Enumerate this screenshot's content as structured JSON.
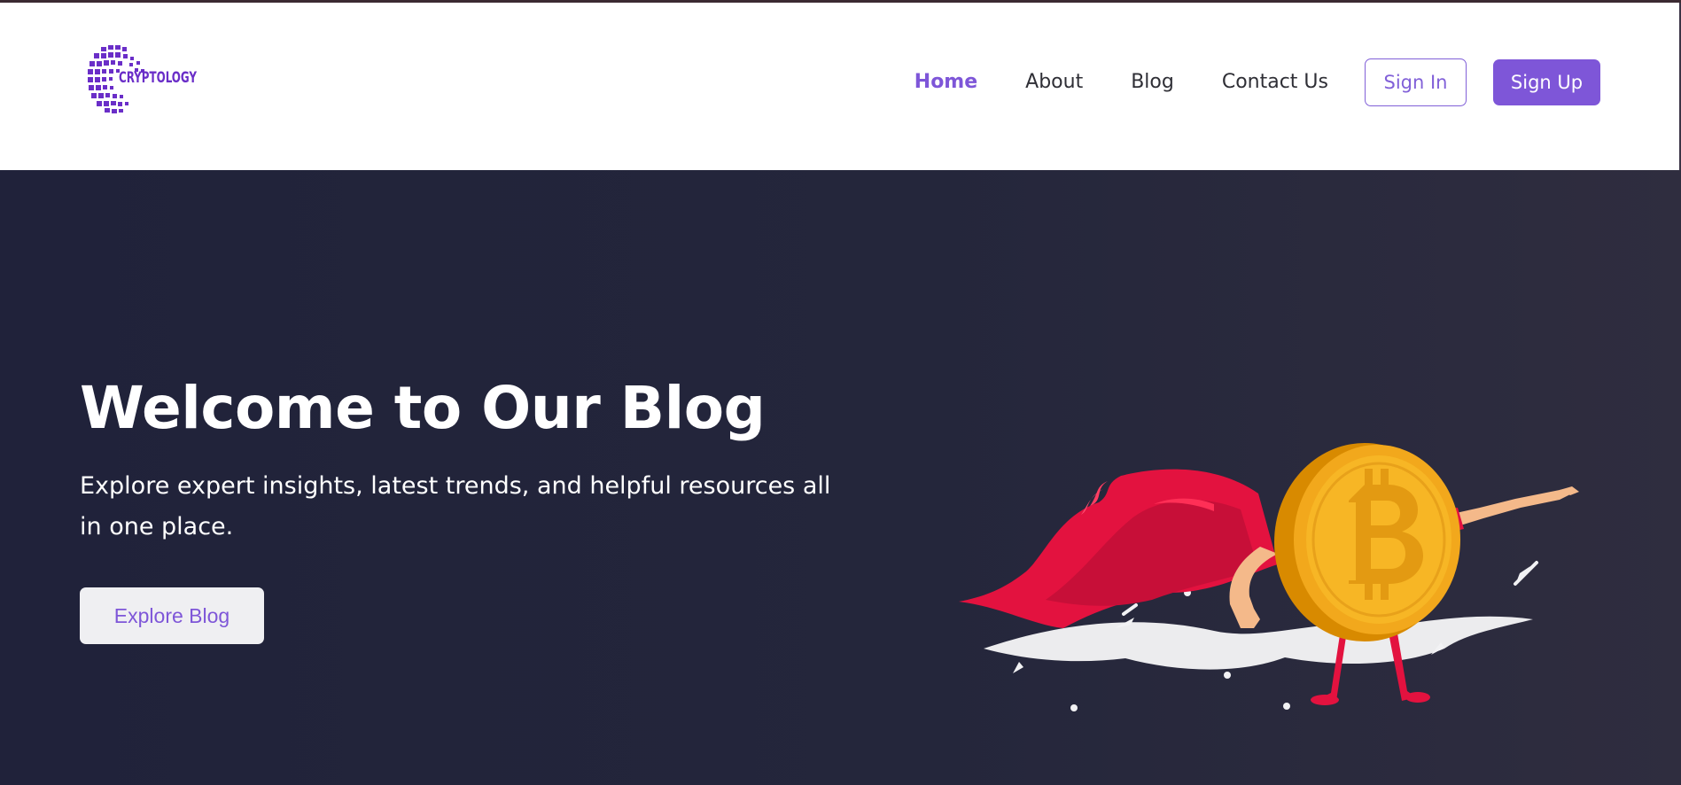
{
  "brand": {
    "name": "CRYPTOLOGY",
    "logo_icon": "pixel-globe-icon",
    "accent_color": "#7e56d8"
  },
  "nav": {
    "links": [
      {
        "label": "Home",
        "active": true
      },
      {
        "label": "About",
        "active": false
      },
      {
        "label": "Blog",
        "active": false
      },
      {
        "label": "Contact Us",
        "active": false
      }
    ],
    "sign_in": "Sign In",
    "sign_up": "Sign Up"
  },
  "hero": {
    "title": "Welcome to Our Blog",
    "subtitle": "Explore expert insights, latest trends, and helpful resources all in one place.",
    "cta": "Explore Blog",
    "background": "#23243a",
    "illustration": "bitcoin-superhero-illustration"
  }
}
